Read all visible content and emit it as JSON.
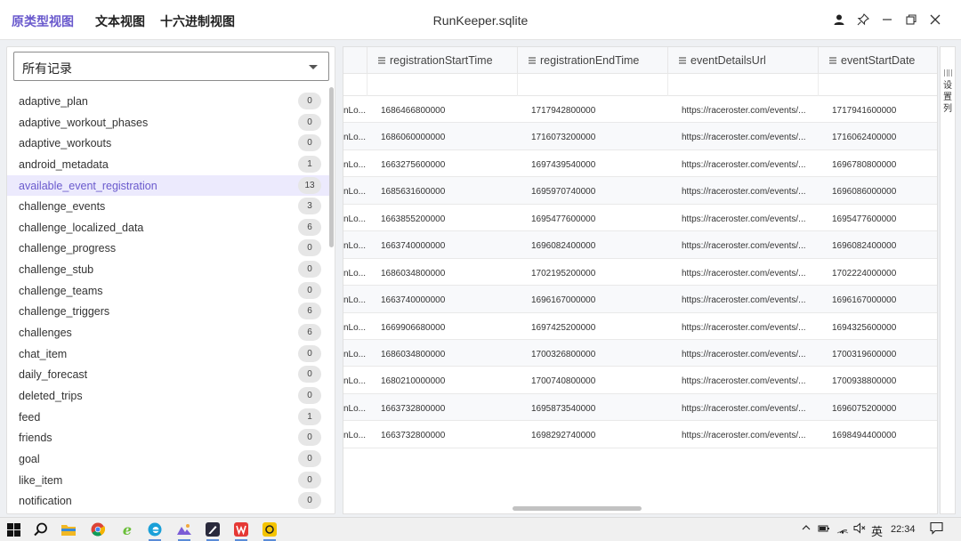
{
  "titlebar": {
    "tabs": [
      {
        "label": "原类型视图"
      },
      {
        "label": "文本视图"
      },
      {
        "label": "十六进制视图"
      }
    ],
    "title": "RunKeeper.sqlite",
    "accent_color": "#6a5acd"
  },
  "sidebar": {
    "filter_value": "所有记录",
    "tables": [
      {
        "name": "adaptive_plan",
        "count": "0"
      },
      {
        "name": "adaptive_workout_phases",
        "count": "0"
      },
      {
        "name": "adaptive_workouts",
        "count": "0"
      },
      {
        "name": "android_metadata",
        "count": "1"
      },
      {
        "name": "available_event_registration",
        "count": "13"
      },
      {
        "name": "challenge_events",
        "count": "3"
      },
      {
        "name": "challenge_localized_data",
        "count": "6"
      },
      {
        "name": "challenge_progress",
        "count": "0"
      },
      {
        "name": "challenge_stub",
        "count": "0"
      },
      {
        "name": "challenge_teams",
        "count": "0"
      },
      {
        "name": "challenge_triggers",
        "count": "6"
      },
      {
        "name": "challenges",
        "count": "6"
      },
      {
        "name": "chat_item",
        "count": "0"
      },
      {
        "name": "daily_forecast",
        "count": "0"
      },
      {
        "name": "deleted_trips",
        "count": "0"
      },
      {
        "name": "feed",
        "count": "1"
      },
      {
        "name": "friends",
        "count": "0"
      },
      {
        "name": "goal",
        "count": "0"
      },
      {
        "name": "like_item",
        "count": "0"
      },
      {
        "name": "notification",
        "count": "0"
      }
    ]
  },
  "grid": {
    "columns": [
      {
        "label": "registrationStartTime"
      },
      {
        "label": "registrationEndTime"
      },
      {
        "label": "eventDetailsUrl"
      },
      {
        "label": "eventStartDate"
      }
    ],
    "rows": [
      {
        "c0": "nLo...",
        "c1": "1686466800000",
        "c2": "1717942800000",
        "c3": "https://raceroster.com/events/...",
        "c4": "1717941600000"
      },
      {
        "c0": "nLo...",
        "c1": "1686060000000",
        "c2": "1716073200000",
        "c3": "https://raceroster.com/events/...",
        "c4": "1716062400000"
      },
      {
        "c0": "nLo...",
        "c1": "1663275600000",
        "c2": "1697439540000",
        "c3": "https://raceroster.com/events/...",
        "c4": "1696780800000"
      },
      {
        "c0": "nLo...",
        "c1": "1685631600000",
        "c2": "1695970740000",
        "c3": "https://raceroster.com/events/...",
        "c4": "1696086000000"
      },
      {
        "c0": "nLo...",
        "c1": "1663855200000",
        "c2": "1695477600000",
        "c3": "https://raceroster.com/events/...",
        "c4": "1695477600000"
      },
      {
        "c0": "nLo...",
        "c1": "1663740000000",
        "c2": "1696082400000",
        "c3": "https://raceroster.com/events/...",
        "c4": "1696082400000"
      },
      {
        "c0": "nLo...",
        "c1": "1686034800000",
        "c2": "1702195200000",
        "c3": "https://raceroster.com/events/...",
        "c4": "1702224000000"
      },
      {
        "c0": "nLo...",
        "c1": "1663740000000",
        "c2": "1696167000000",
        "c3": "https://raceroster.com/events/...",
        "c4": "1696167000000"
      },
      {
        "c0": "nLo...",
        "c1": "1669906680000",
        "c2": "1697425200000",
        "c3": "https://raceroster.com/events/...",
        "c4": "1694325600000"
      },
      {
        "c0": "nLo...",
        "c1": "1686034800000",
        "c2": "1700326800000",
        "c3": "https://raceroster.com/events/...",
        "c4": "1700319600000"
      },
      {
        "c0": "nLo...",
        "c1": "1680210000000",
        "c2": "1700740800000",
        "c3": "https://raceroster.com/events/...",
        "c4": "1700938800000"
      },
      {
        "c0": "nLo...",
        "c1": "1663732800000",
        "c2": "1695873540000",
        "c3": "https://raceroster.com/events/...",
        "c4": "1696075200000"
      },
      {
        "c0": "nLo...",
        "c1": "1663732800000",
        "c2": "1698292740000",
        "c3": "https://raceroster.com/events/...",
        "c4": "1698494400000"
      }
    ]
  },
  "side_panel": {
    "label": "设置列"
  },
  "taskbar": {
    "lang": "英",
    "time": "22:34",
    "icons": [
      "windows-start-icon",
      "search-icon",
      "file-explorer-icon",
      "chrome-icon",
      "ie-browser-icon",
      "edge-icon",
      "image-viewer-icon",
      "pen-app-icon",
      "wps-office-icon",
      "yellow-app-icon"
    ]
  }
}
